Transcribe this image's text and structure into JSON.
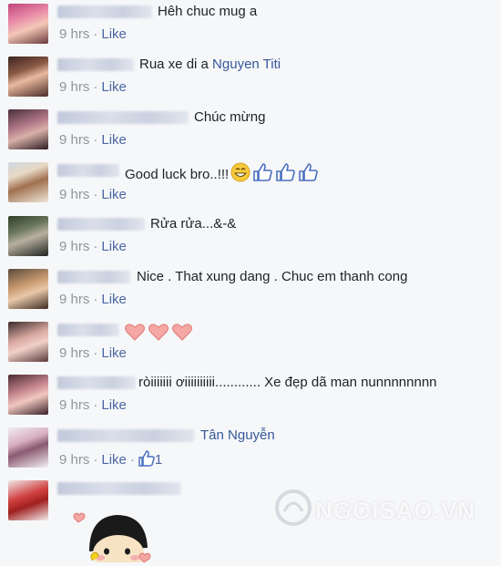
{
  "comments": [
    {
      "text": "Hêh chuc mug a",
      "mention": "",
      "time": "9 hrs",
      "like": "Like"
    },
    {
      "text": "Rua xe di a ",
      "mention": "Nguyen Titi",
      "time": "9 hrs",
      "like": "Like"
    },
    {
      "text": "Chúc mừng",
      "mention": "",
      "time": "9 hrs",
      "like": "Like"
    },
    {
      "text": "Good luck bro..!!!",
      "mention": "",
      "time": "9 hrs",
      "like": "Like"
    },
    {
      "text": "Rửa rửa...&-&",
      "mention": "",
      "time": "9 hrs",
      "like": "Like"
    },
    {
      "text": "Nice . That xung dang . Chuc em thanh cong",
      "mention": "",
      "time": "9 hrs",
      "like": "Like"
    },
    {
      "text": "",
      "mention": "",
      "time": "9 hrs",
      "like": "Like"
    },
    {
      "text": "ròiiiiiii ơiiiiiiiiii............ Xe đẹp dã man nunnnnnnnn",
      "mention": "",
      "time": "9 hrs",
      "like": "Like"
    },
    {
      "text": "",
      "mention": "Tân Nguyễn",
      "time": "9 hrs",
      "like": "Like",
      "like_count": "1"
    }
  ],
  "separator": "·",
  "watermark": "NGOISAO.VN",
  "colors": {
    "link": "#365899",
    "meta": "#90949c",
    "like": "#4b67a1",
    "heart": "#f4a7a3"
  }
}
